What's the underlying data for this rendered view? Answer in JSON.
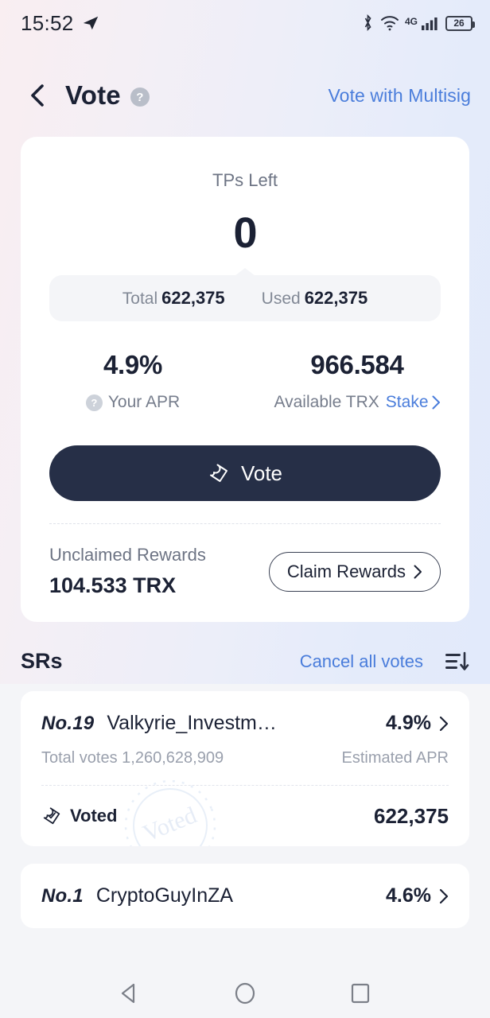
{
  "status_bar": {
    "time": "15:52",
    "icons": [
      "telegram-icon",
      "bluetooth-icon",
      "wifi-icon",
      "signal-icon"
    ],
    "network": "4G",
    "battery_percent": "26"
  },
  "header": {
    "back_icon": "chevron-left-icon",
    "title": "Vote",
    "help_icon": "?",
    "multisig_link": "Vote with Multisig"
  },
  "summary_card": {
    "tps_label": "TPs Left",
    "tps_value": "0",
    "total_label": "Total",
    "total_value": "622,375",
    "used_label": "Used",
    "used_value": "622,375",
    "apr_value": "4.9%",
    "apr_label": "Your APR",
    "apr_help_icon": "?",
    "trx_value": "966.584",
    "trx_label": "Available TRX",
    "stake_link": "Stake",
    "vote_button": "Vote",
    "vote_icon": "ballot-icon",
    "unclaimed_label": "Unclaimed Rewards",
    "unclaimed_value": "104.533 TRX",
    "claim_button": "Claim Rewards"
  },
  "srs_section": {
    "title": "SRs",
    "cancel_all": "Cancel all votes",
    "sort_icon": "sort-descending-icon",
    "items": [
      {
        "rank": "No.19",
        "name": "Valkyrie_Investm…",
        "apr": "4.9%",
        "total_votes_label": "Total votes",
        "total_votes": "1,260,628,909",
        "estimated_apr_label": "Estimated APR",
        "voted_label": "Voted",
        "voted_icon": "ballot-check-icon",
        "voted_amount": "622,375",
        "stamp_text": "Voted"
      },
      {
        "rank": "No.1",
        "name": "CryptoGuyInZA",
        "apr": "4.6%"
      }
    ]
  },
  "navigation_bar": {
    "back": "back-triangle-icon",
    "home": "home-circle-icon",
    "recents": "recents-square-icon"
  },
  "colors": {
    "accent_blue": "#4a7ddb",
    "dark_navy": "#262f47",
    "muted_text": "#6d7484",
    "page_bg": "#f4f5f8"
  }
}
